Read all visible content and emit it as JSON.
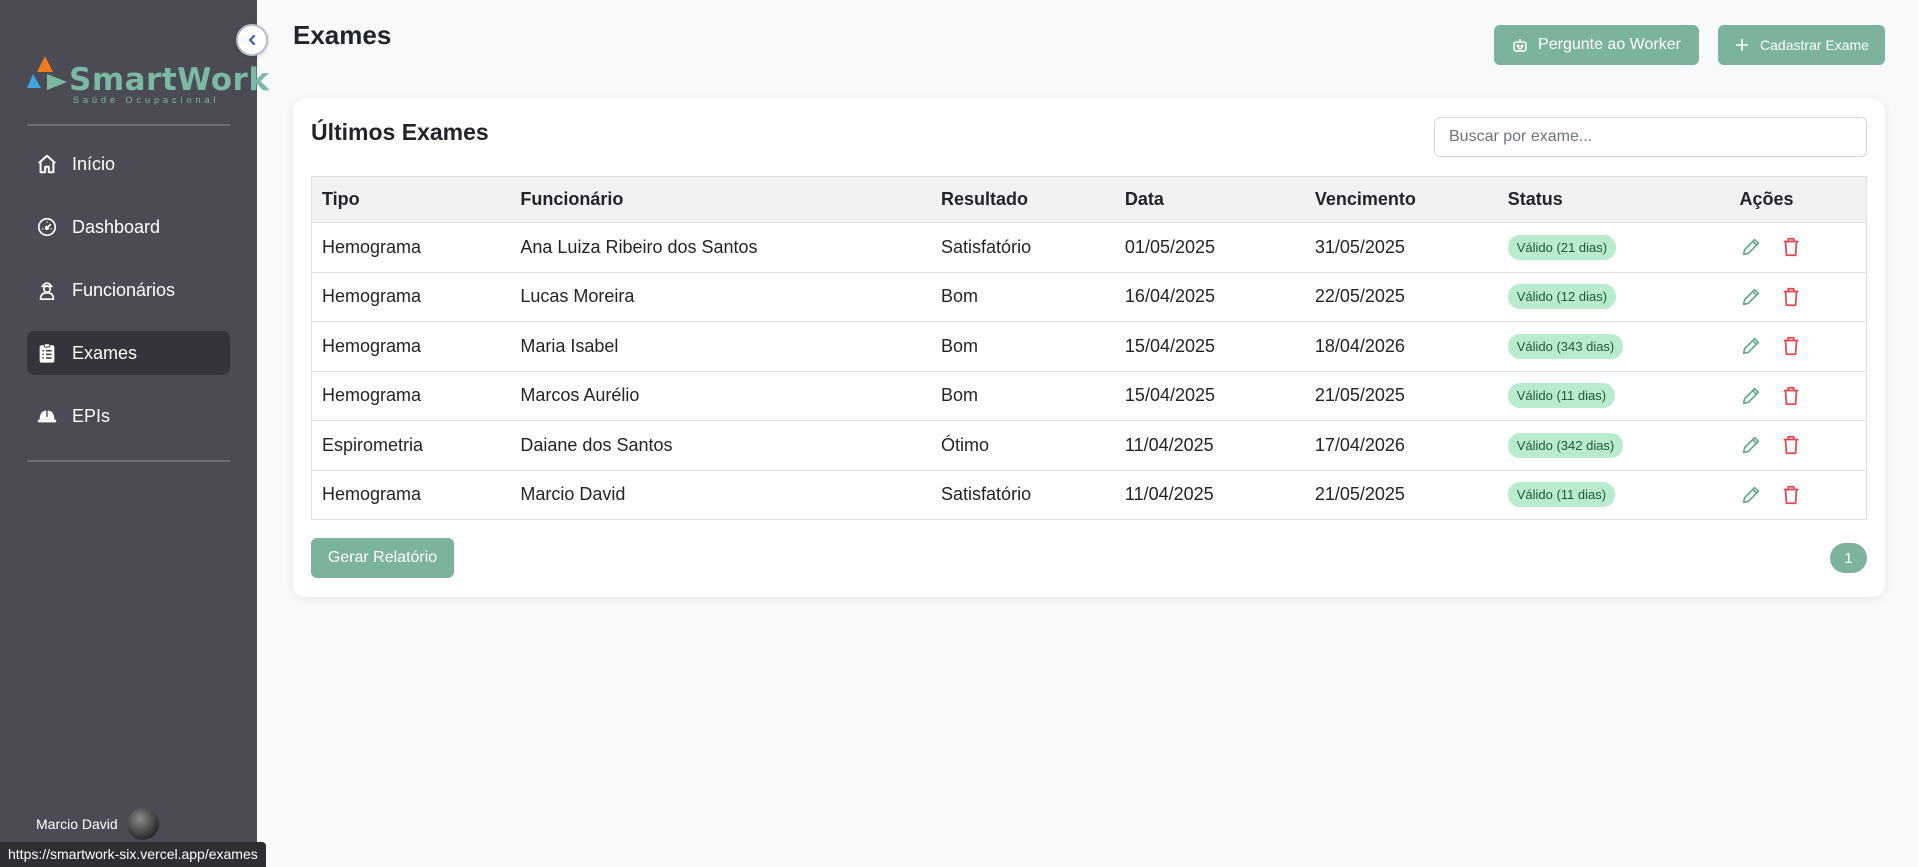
{
  "sidebar": {
    "logo_text": "SmartWork",
    "logo_tagline": "Saúde Ocupacional",
    "items": [
      {
        "label": "Início",
        "icon": "home-icon"
      },
      {
        "label": "Dashboard",
        "icon": "gauge-icon"
      },
      {
        "label": "Funcionários",
        "icon": "worker-icon"
      },
      {
        "label": "Exames",
        "icon": "clipboard-icon",
        "active": true
      },
      {
        "label": "EPIs",
        "icon": "helmet-icon"
      }
    ],
    "user_name": "Marcio David"
  },
  "status_url": "https://smartwork-six.vercel.app/exames",
  "header": {
    "title": "Exames",
    "worker_button": "Pergunte ao Worker",
    "add_button": "Cadastrar Exame"
  },
  "card": {
    "title": "Últimos Exames",
    "search_placeholder": "Buscar por exame...",
    "columns": [
      "Tipo",
      "Funcionário",
      "Resultado",
      "Data",
      "Vencimento",
      "Status",
      "Ações"
    ],
    "rows": [
      [
        "Hemograma",
        "Ana Luiza Ribeiro dos Santos",
        "Satisfatório",
        "01/05/2025",
        "31/05/2025",
        "Válido (21 dias)"
      ],
      [
        "Hemograma",
        "Lucas Moreira",
        "Bom",
        "16/04/2025",
        "22/05/2025",
        "Válido (12 dias)"
      ],
      [
        "Hemograma",
        "Maria Isabel",
        "Bom",
        "15/04/2025",
        "18/04/2026",
        "Válido (343 dias)"
      ],
      [
        "Hemograma",
        "Marcos Aurélio",
        "Bom",
        "15/04/2025",
        "21/05/2025",
        "Válido (11 dias)"
      ],
      [
        "Espirometria",
        "Daiane dos Santos",
        "Ótimo",
        "11/04/2025",
        "17/04/2026",
        "Válido (342 dias)"
      ],
      [
        "Hemograma",
        "Marcio David",
        "Satisfatório",
        "11/04/2025",
        "21/05/2025",
        "Válido (11 dias)"
      ]
    ],
    "report_button": "Gerar Relatório",
    "current_page": "1"
  },
  "colors": {
    "sidebar_bg": "#4b4b55",
    "accent": "#7cb39d",
    "badge_bg": "#b9ebcf",
    "edit_icon": "#5fa88a",
    "delete_icon": "#e0474f"
  }
}
